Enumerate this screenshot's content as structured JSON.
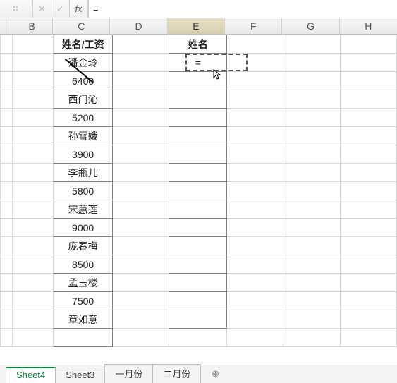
{
  "formula_bar": {
    "cancel_icon": "✕",
    "confirm_icon": "✓",
    "fx_label": "fx",
    "value": "="
  },
  "columns": {
    "B": "B",
    "C": "C",
    "D": "D",
    "E": "E",
    "F": "F",
    "G": "G",
    "H": "H"
  },
  "headers": {
    "C": "姓名/工资",
    "E": "姓名"
  },
  "col_c_data": [
    "潘金玲",
    "6400",
    "西门沁",
    "5200",
    "孙雪娥",
    "3900",
    "李瓶儿",
    "5800",
    "宋蕙莲",
    "9000",
    "庞春梅",
    "8500",
    "孟玉楼",
    "7500",
    "章如意"
  ],
  "active_cell_value": "=",
  "sheet_tabs": {
    "t0": "Sheet4",
    "t1": "Sheet3",
    "t2": "一月份",
    "t3": "二月份"
  },
  "new_sheet_icon": "⊕"
}
